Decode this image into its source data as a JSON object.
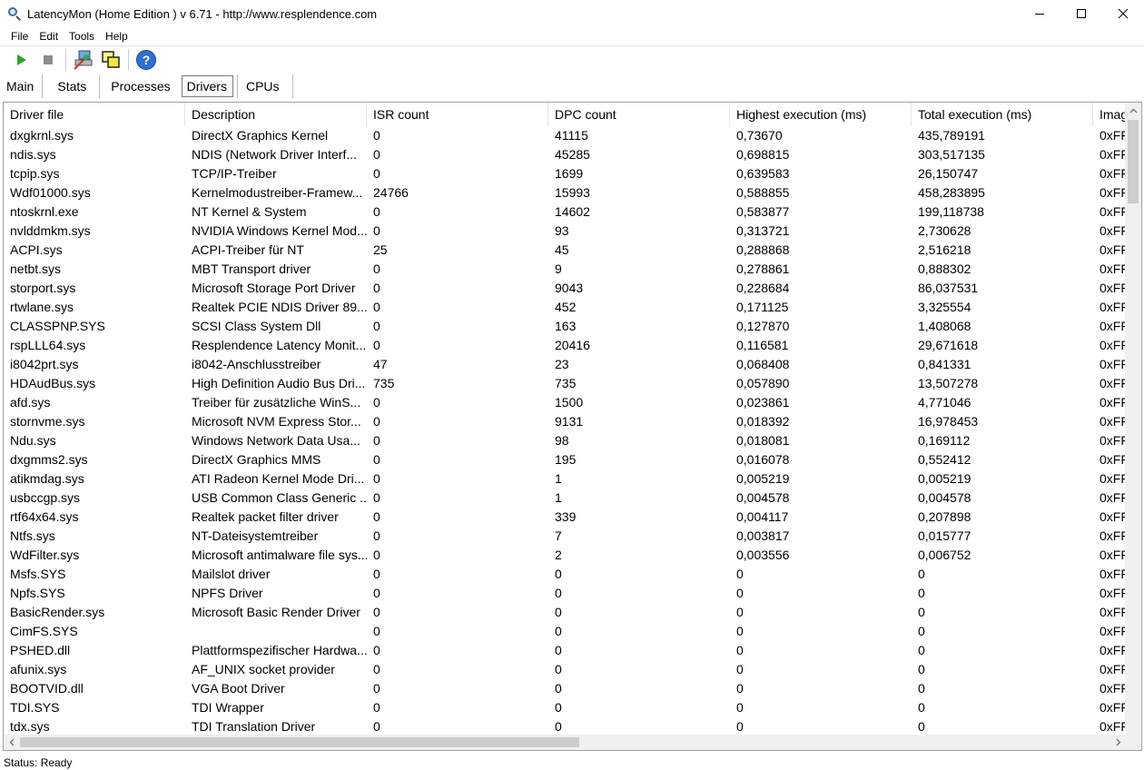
{
  "window": {
    "title": "LatencyMon  (Home Edition )  v 6.71 - http://www.resplendence.com"
  },
  "menu": [
    {
      "label": "File"
    },
    {
      "label": "Edit"
    },
    {
      "label": "Tools"
    },
    {
      "label": "Help"
    }
  ],
  "toolbar": {
    "icons": [
      "play-icon",
      "stop-icon",
      "computer-icon",
      "windows-icon",
      "help-icon"
    ]
  },
  "tabs": [
    {
      "label": "Main",
      "active": false
    },
    {
      "label": "Stats",
      "active": false
    },
    {
      "label": "Processes",
      "active": false
    },
    {
      "label": "Drivers",
      "active": true
    },
    {
      "label": "CPUs",
      "active": false
    }
  ],
  "table": {
    "columns": [
      "Driver file",
      "Description",
      "ISR count",
      "DPC count",
      "Highest execution (ms)",
      "Total execution (ms)",
      "Imag"
    ],
    "rows": [
      [
        "dxgkrnl.sys",
        "DirectX Graphics Kernel",
        "0",
        "41115",
        "0,73670",
        "435,789191",
        "0xFF"
      ],
      [
        "ndis.sys",
        "NDIS (Network Driver Interf...",
        "0",
        "45285",
        "0,698815",
        "303,517135",
        "0xFF"
      ],
      [
        "tcpip.sys",
        "TCP/IP-Treiber",
        "0",
        "1699",
        "0,639583",
        "26,150747",
        "0xFF"
      ],
      [
        "Wdf01000.sys",
        "Kernelmodustreiber-Framew...",
        "24766",
        "15993",
        "0,588855",
        "458,283895",
        "0xFF"
      ],
      [
        "ntoskrnl.exe",
        "NT Kernel & System",
        "0",
        "14602",
        "0,583877",
        "199,118738",
        "0xFF"
      ],
      [
        "nvlddmkm.sys",
        "NVIDIA Windows Kernel Mod...",
        "0",
        "93",
        "0,313721",
        "2,730628",
        "0xFF"
      ],
      [
        "ACPI.sys",
        "ACPI-Treiber für NT",
        "25",
        "45",
        "0,288868",
        "2,516218",
        "0xFF"
      ],
      [
        "netbt.sys",
        "MBT Transport driver",
        "0",
        "9",
        "0,278861",
        "0,888302",
        "0xFF"
      ],
      [
        "storport.sys",
        "Microsoft Storage Port Driver",
        "0",
        "9043",
        "0,228684",
        "86,037531",
        "0xFF"
      ],
      [
        "rtwlane.sys",
        "Realtek PCIE NDIS Driver 89...",
        "0",
        "452",
        "0,171125",
        "3,325554",
        "0xFF"
      ],
      [
        "CLASSPNP.SYS",
        "SCSI Class System Dll",
        "0",
        "163",
        "0,127870",
        "1,408068",
        "0xFF"
      ],
      [
        "rspLLL64.sys",
        "Resplendence Latency Monit...",
        "0",
        "20416",
        "0,116581",
        "29,671618",
        "0xFF"
      ],
      [
        "i8042prt.sys",
        "i8042-Anschlusstreiber",
        "47",
        "23",
        "0,068408",
        "0,841331",
        "0xFF"
      ],
      [
        "HDAudBus.sys",
        "High Definition Audio Bus Dri...",
        "735",
        "735",
        "0,057890",
        "13,507278",
        "0xFF"
      ],
      [
        "afd.sys",
        "Treiber für zusätzliche WinS...",
        "0",
        "1500",
        "0,023861",
        "4,771046",
        "0xFF"
      ],
      [
        "stornvme.sys",
        "Microsoft NVM Express Stor...",
        "0",
        "9131",
        "0,018392",
        "16,978453",
        "0xFF"
      ],
      [
        "Ndu.sys",
        "Windows Network Data Usa...",
        "0",
        "98",
        "0,018081",
        "0,169112",
        "0xFF"
      ],
      [
        "dxgmms2.sys",
        "DirectX Graphics MMS",
        "0",
        "195",
        "0,016078",
        "0,552412",
        "0xFF"
      ],
      [
        "atikmdag.sys",
        "ATI Radeon Kernel Mode Dri...",
        "0",
        "1",
        "0,005219",
        "0,005219",
        "0xFF"
      ],
      [
        "usbccgp.sys",
        "USB Common Class Generic ...",
        "0",
        "1",
        "0,004578",
        "0,004578",
        "0xFF"
      ],
      [
        "rtf64x64.sys",
        "Realtek packet filter driver",
        "0",
        "339",
        "0,004117",
        "0,207898",
        "0xFF"
      ],
      [
        "Ntfs.sys",
        "NT-Dateisystemtreiber",
        "0",
        "7",
        "0,003817",
        "0,015777",
        "0xFF"
      ],
      [
        "WdFilter.sys",
        "Microsoft antimalware file sys...",
        "0",
        "2",
        "0,003556",
        "0,006752",
        "0xFF"
      ],
      [
        "Msfs.SYS",
        "Mailslot driver",
        "0",
        "0",
        "0",
        "0",
        "0xFF"
      ],
      [
        "Npfs.SYS",
        "NPFS Driver",
        "0",
        "0",
        "0",
        "0",
        "0xFF"
      ],
      [
        "BasicRender.sys",
        "Microsoft Basic Render Driver",
        "0",
        "0",
        "0",
        "0",
        "0xFF"
      ],
      [
        "CimFS.SYS",
        "",
        "0",
        "0",
        "0",
        "0",
        "0xFF"
      ],
      [
        "PSHED.dll",
        "Plattformspezifischer Hardwa...",
        "0",
        "0",
        "0",
        "0",
        "0xFF"
      ],
      [
        "afunix.sys",
        "AF_UNIX socket provider",
        "0",
        "0",
        "0",
        "0",
        "0xFF"
      ],
      [
        "BOOTVID.dll",
        "VGA Boot Driver",
        "0",
        "0",
        "0",
        "0",
        "0xFF"
      ],
      [
        "TDI.SYS",
        "TDI Wrapper",
        "0",
        "0",
        "0",
        "0",
        "0xFF"
      ],
      [
        "tdx.sys",
        "TDI Translation Driver",
        "0",
        "0",
        "0",
        "0",
        "0xFF"
      ]
    ]
  },
  "status": {
    "text": "Status: Ready"
  }
}
